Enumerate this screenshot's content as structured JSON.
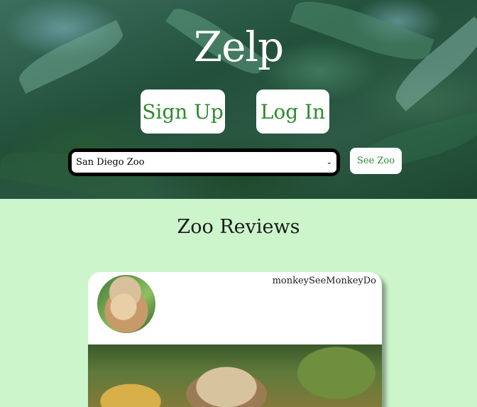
{
  "header": {
    "title": "Zelp",
    "signup_label": "Sign Up",
    "login_label": "Log In"
  },
  "zoo_select": {
    "selected": "San Diego Zoo",
    "button_label": "See Zoo"
  },
  "reviews": {
    "heading": "Zoo Reviews",
    "items": [
      {
        "username": "monkeySeeMonkeyDo"
      }
    ]
  }
}
